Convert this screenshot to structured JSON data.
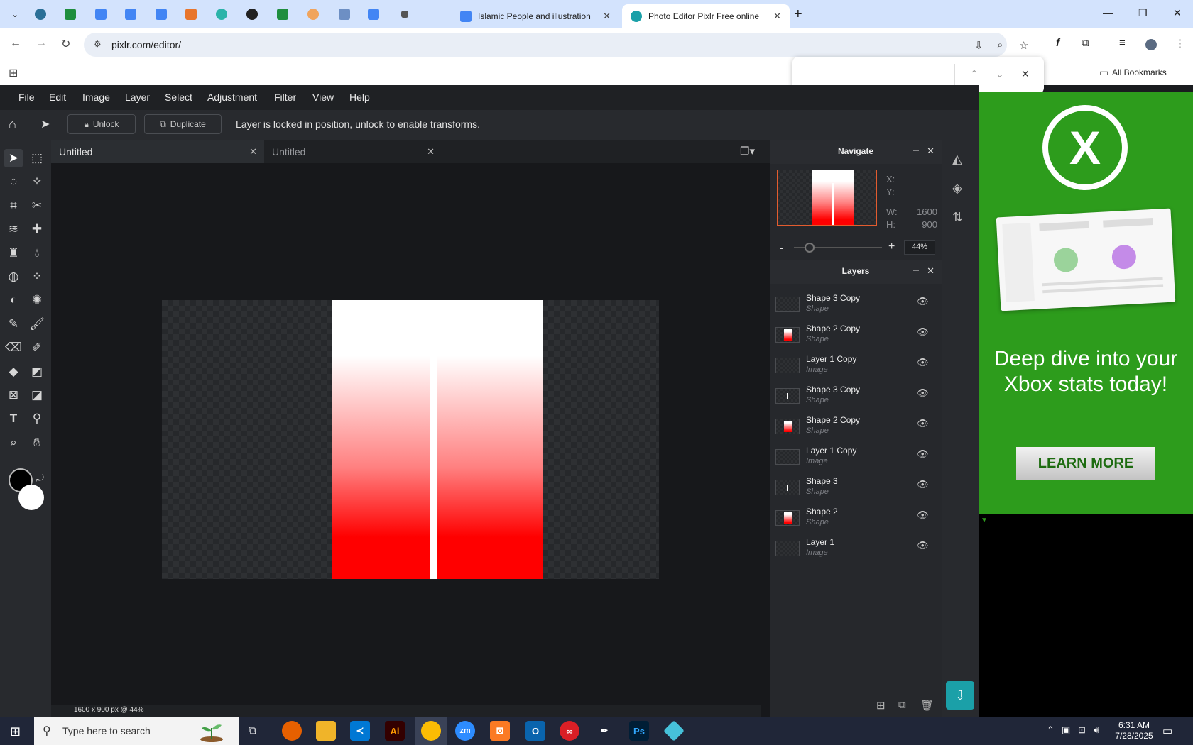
{
  "browser": {
    "tabs": [
      {
        "title": "Islamic People and illustration v",
        "active": false
      },
      {
        "title": "Photo Editor Pixlr Free online In",
        "active": true
      }
    ],
    "url": "pixlr.com/editor/",
    "bookmarks_label": "All Bookmarks"
  },
  "menu": [
    "File",
    "Edit",
    "Image",
    "Layer",
    "Select",
    "Adjustment",
    "Filter",
    "View",
    "Help"
  ],
  "tool_options": {
    "unlock_label": "Unlock",
    "duplicate_label": "Duplicate",
    "message": "Layer is locked in position, unlock to enable transforms."
  },
  "doc_tabs": [
    {
      "title": "Untitled",
      "active": true
    },
    {
      "title": "Untitled",
      "active": false
    }
  ],
  "status": "1600 x 900 px @ 44%",
  "navigate": {
    "title": "Navigate",
    "x_label": "X:",
    "y_label": "Y:",
    "w_label": "W:",
    "w_value": "1600",
    "h_label": "H:",
    "h_value": "900",
    "zoom_minus": "-",
    "zoom_plus": "+",
    "zoom": "44%",
    "zoom_level": 0.44
  },
  "layers": {
    "title": "Layers",
    "items": [
      {
        "name": "Shape 3 Copy",
        "type": "Shape"
      },
      {
        "name": "Shape 2 Copy",
        "type": "Shape"
      },
      {
        "name": "Layer 1 Copy",
        "type": "Image"
      },
      {
        "name": "Shape 3 Copy",
        "type": "Shape"
      },
      {
        "name": "Shape 2 Copy",
        "type": "Shape"
      },
      {
        "name": "Layer 1 Copy",
        "type": "Image"
      },
      {
        "name": "Shape 3",
        "type": "Shape"
      },
      {
        "name": "Shape 2",
        "type": "Shape"
      },
      {
        "name": "Layer 1",
        "type": "Image"
      }
    ]
  },
  "ad": {
    "headline": "Deep dive into your Xbox stats today!",
    "cta": "LEARN MORE",
    "brand_color": "#2d9c1c"
  },
  "taskbar": {
    "search_placeholder": "Type here to search",
    "time": "6:31 AM",
    "date": "7/28/2025"
  },
  "colors": {
    "accent": "#1ba0a8",
    "canvas_red": "#ff0000"
  }
}
